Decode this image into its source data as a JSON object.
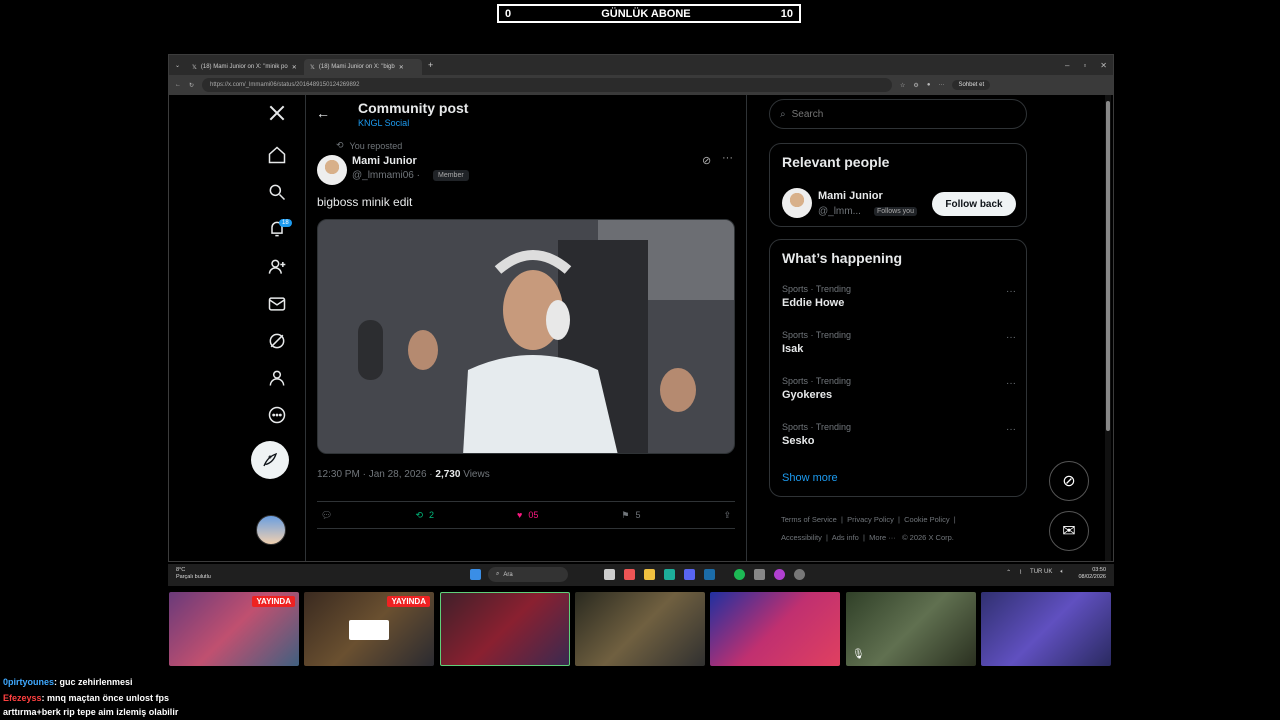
{
  "sub_goal": {
    "current": "0",
    "label": "GÜNLÜK ABONE",
    "target": "10"
  },
  "browser": {
    "tabs": [
      {
        "label": "(18) Mami Junior on X: \"minik po"
      },
      {
        "label": "(18) Mami Junior on X: \"bigb"
      }
    ],
    "url": "https://x.com/_lmmami06/status/2016489150124269892",
    "sohbet_label": "Sohbet et"
  },
  "page": {
    "title": "Community post",
    "community": "KNGL Social",
    "notif_count": "18",
    "repost_note": "You reposted",
    "author": {
      "name": "Mami Junior",
      "handle": "@_lmmami06 ·",
      "badge": "Member"
    },
    "text": "bigboss minik edit",
    "meta": {
      "time": "12:30 PM · Jan 28, 2026 ·",
      "views": "2,730",
      "views_label": "Views"
    },
    "actions": {
      "reposts": "2",
      "likes": "05",
      "bookmarks": "5"
    }
  },
  "sidebar": {
    "search_placeholder": "Search",
    "relevant_title": "Relevant people",
    "relevant": {
      "name": "Mami Junior",
      "handle": "@_lmm...",
      "follows_you": "Follows you",
      "follow_label": "Follow back"
    },
    "happening_title": "What’s happening",
    "trends": [
      {
        "category": "Sports · Trending",
        "name": "Eddie Howe"
      },
      {
        "category": "Sports · Trending",
        "name": "Isak"
      },
      {
        "category": "Sports · Trending",
        "name": "Gyokeres"
      },
      {
        "category": "Sports · Trending",
        "name": "Sesko"
      }
    ],
    "show_more": "Show more",
    "footer": [
      "Terms of Service",
      "Privacy Policy",
      "Cookie Policy",
      "Accessibility",
      "Ads info",
      "More ···",
      "© 2026 X Corp."
    ]
  },
  "taskbar": {
    "weather_temp": "8°C",
    "weather_desc": "Parçalı bulutlu",
    "search_label": "Ara",
    "lang": "TUR",
    "lang2": "UK",
    "time": "03:50",
    "date": "08/02/2026"
  },
  "cams": {
    "live_label": "YAYINDA"
  },
  "chat": [
    {
      "user": "0pirtyounes",
      "message": ": guc zehirlenmesi",
      "color": "#3fa9ff"
    },
    {
      "user": "Efezeyss",
      "message": ": mnq maçtan önce unlost fps",
      "color": "#ff4040"
    },
    {
      "user": "",
      "message": "arttırma+berk rip tepe aim izlemiş olabilir",
      "color": "#ffffff"
    }
  ],
  "colors": {
    "accent": "#1d9bf0",
    "like": "#f91880",
    "repost": "#00ba7c"
  }
}
